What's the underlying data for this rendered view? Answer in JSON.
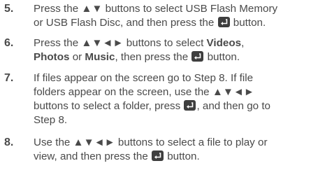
{
  "icons": {
    "enter": "enter-button-icon"
  },
  "steps": [
    {
      "number": "5.",
      "lines": [
        {
          "a": "Press the ▲▼ buttons to select USB Flash Memory"
        },
        {
          "a": "or USB Flash Disc, and then press the ",
          "b": " button."
        }
      ]
    },
    {
      "number": "6.",
      "lines": [
        {
          "a": "Press the ▲▼◄► buttons to select ",
          "b": "Videos",
          "c": ","
        },
        {
          "a": "Photos",
          "b": " or ",
          "c": "Music",
          "d": ", then press the ",
          "e": " button."
        }
      ]
    },
    {
      "number": "7.",
      "lines": [
        {
          "a": "If files appear on the screen go to Step 8. If file"
        },
        {
          "a": "folders appear on the screen, use the ▲▼◄►"
        },
        {
          "a": "buttons to select a folder, press ",
          "b": ", and then go to"
        },
        {
          "a": "Step 8."
        }
      ]
    },
    {
      "number": "8.",
      "lines": [
        {
          "a": "Use the ▲▼◄► buttons to select a file to play or"
        },
        {
          "a": "view, and then press the ",
          "b": " button."
        }
      ]
    }
  ]
}
